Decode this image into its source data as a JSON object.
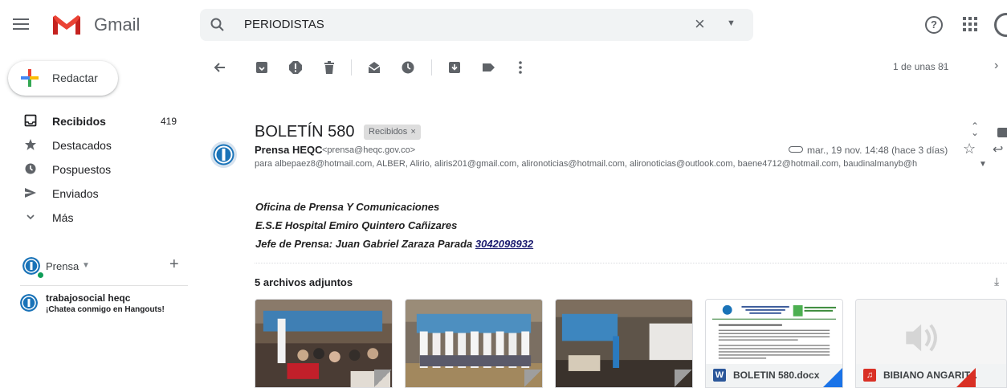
{
  "app": {
    "name": "Gmail"
  },
  "search": {
    "query": "PERIODISTAS"
  },
  "compose": {
    "label": "Redactar"
  },
  "nav": {
    "items": [
      {
        "label": "Recibidos",
        "count": "419",
        "icon": "inbox-icon"
      },
      {
        "label": "Destacados",
        "count": "",
        "icon": "star-icon"
      },
      {
        "label": "Pospuestos",
        "count": "",
        "icon": "clock-icon"
      },
      {
        "label": "Enviados",
        "count": "",
        "icon": "send-icon"
      },
      {
        "label": "Más",
        "count": "",
        "icon": "chevron-down-icon"
      }
    ]
  },
  "hangouts": {
    "user_label": "Prensa",
    "contact_name": "trabajosocial heqc",
    "contact_status": "¡Chatea conmigo en Hangouts!"
  },
  "toolbar": {
    "pager": "1 de unas 81"
  },
  "message": {
    "subject": "BOLETÍN 580",
    "label": "Recibidos",
    "sender_name": "Prensa HEQC",
    "sender_email": "<prensa@heqc.gov.co>",
    "date": "mar., 19 nov. 14:48 (hace 3 días)",
    "recipients": "para albepaez8@hotmail.com, ALBER, Alirio, aliris201@gmail.com, alironoticias@hotmail.com, alironoticias@outlook.com, baene4712@hotmail.com, baudinalmanyb@h",
    "signature": {
      "line1": "Oficina de Prensa Y Comunicaciones",
      "line2": "E.S.E Hospital Emiro Quintero Cañizares",
      "line3": "Jefe de Prensa: Juan Gabriel Zaraza Parada ",
      "phone": "3042098932"
    }
  },
  "attachments": {
    "title": "5 archivos adjuntos",
    "files": [
      {
        "name": "",
        "type": "photo"
      },
      {
        "name": "",
        "type": "photo"
      },
      {
        "name": "",
        "type": "photo"
      },
      {
        "name": "BOLETIN 580.docx",
        "type": "docx",
        "icon_letter": "W",
        "color": "#2b579a",
        "corner": "#1a73e8"
      },
      {
        "name": "BIBIANO ANGARIT...",
        "type": "audio",
        "icon_letter": "♫",
        "color": "#d93025",
        "corner": "#d93025"
      }
    ]
  },
  "colors": {
    "gmail_red": "#ea4335",
    "hangouts_online": "#0f9d58",
    "avatar_blue": "#1a73b8"
  }
}
